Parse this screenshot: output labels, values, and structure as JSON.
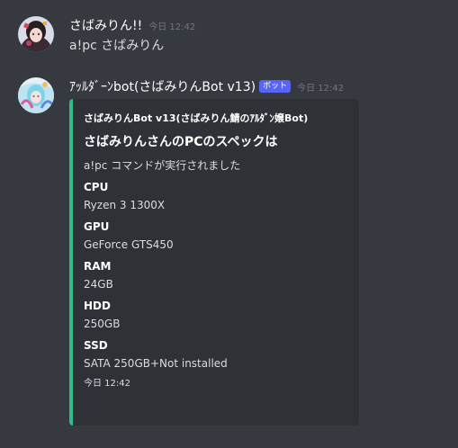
{
  "messages": [
    {
      "username": "さばみりん!!",
      "timestamp": "今日 12:42",
      "text": "a!pc さばみりん",
      "avatar_icon": "user-avatar-icon"
    },
    {
      "username": "ｱｯﾙﾀﾞｰﾝbot(さばみりんBot v13)",
      "bot_tag": "ボット",
      "timestamp": "今日 12:42",
      "avatar_icon": "bot-avatar-icon",
      "embed": {
        "accent_color": "#2ebd87",
        "author": "さばみりんBot v13(さばみりん鯖のｱﾙﾀﾞﾝ嬢Bot)",
        "title": "さばみりんさんのPCのスペックは",
        "description": "a!pc コマンドが実行されました",
        "fields": [
          {
            "name": "CPU",
            "value": "Ryzen 3 1300X"
          },
          {
            "name": "GPU",
            "value": "GeForce GTS450"
          },
          {
            "name": "RAM",
            "value": "24GB"
          },
          {
            "name": "HDD",
            "value": "250GB"
          },
          {
            "name": "SSD",
            "value": "SATA 250GB+Not installed"
          }
        ],
        "footer": "今日 12:42"
      }
    }
  ],
  "colors": {
    "background": "#36393f",
    "embed_background": "#2f3136",
    "bot_tag": "#5865f2",
    "timestamp": "#72767d"
  }
}
